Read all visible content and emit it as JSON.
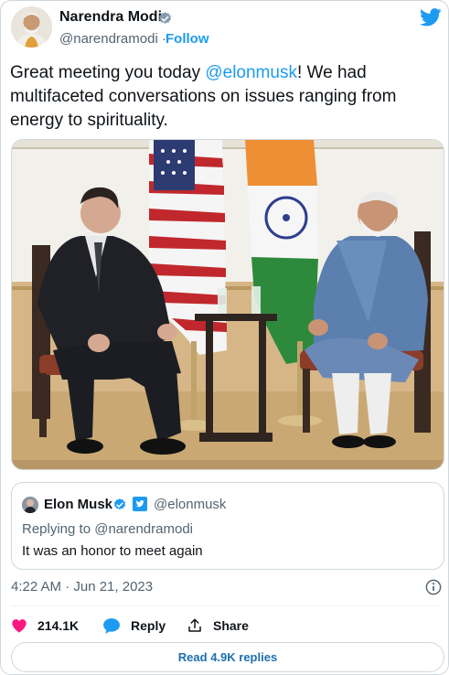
{
  "author": {
    "name": "Narendra Modi",
    "handle": "@narendramodi",
    "separator": "·",
    "follow_label": "Follow"
  },
  "tweet": {
    "text_before": "Great meeting you today ",
    "mention": "@elonmusk",
    "text_after": "! We had multifaceted conversations on issues ranging from energy to spirituality."
  },
  "quoted": {
    "name": "Elon Musk",
    "handle": "@elonmusk",
    "replying_to": "Replying to @narendramodi",
    "text": "It was an honor to meet again"
  },
  "timestamp": "4:22 AM · Jun 21, 2023",
  "actions": {
    "likes": "214.1K",
    "reply_label": "Reply",
    "share_label": "Share"
  },
  "read_replies_label": "Read 4.9K replies",
  "colors": {
    "accent": "#1d9bf0",
    "like": "#f91880",
    "text": "#0f1419",
    "muted": "#536471"
  },
  "icons": [
    "verified-badge-icon",
    "twitter-logo-icon",
    "heart-icon",
    "reply-bubble-icon",
    "share-icon",
    "info-icon"
  ]
}
